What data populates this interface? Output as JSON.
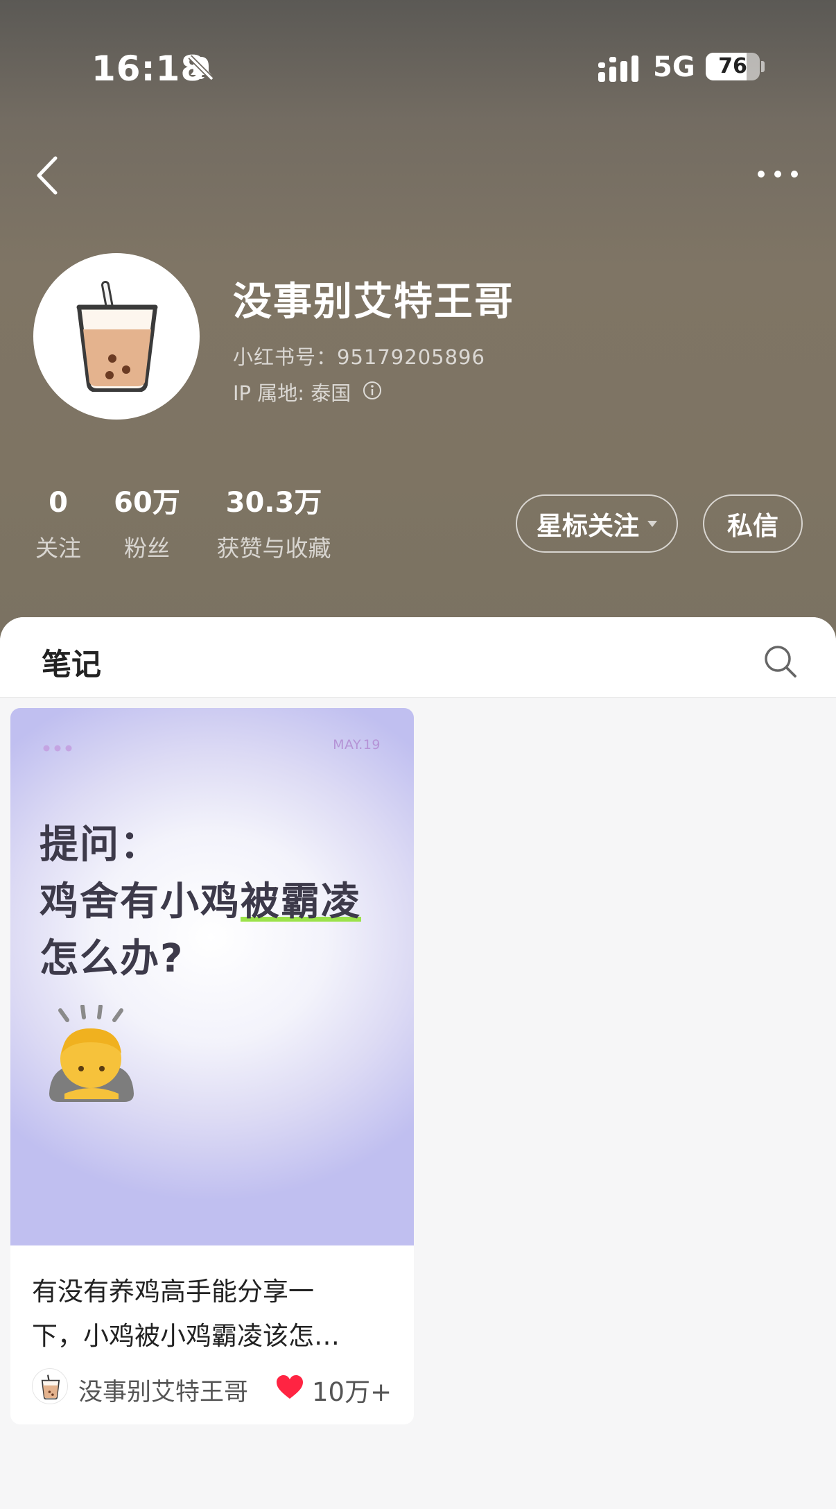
{
  "status_bar": {
    "time": "16:18",
    "network": "5G",
    "battery": "76",
    "battery_level": 0.76
  },
  "profile": {
    "name": "没事别艾特王哥",
    "red_id": "小红书号：95179205896",
    "ip_location": "IP 属地: 泰国"
  },
  "stats": [
    {
      "value": "0",
      "label": "关注"
    },
    {
      "value": "60万",
      "label": "粉丝"
    },
    {
      "value": "30.3万",
      "label": "获赞与收藏"
    }
  ],
  "actions": {
    "follow_label": "星标关注",
    "message_label": "私信"
  },
  "tabs": {
    "notes_label": "笔记"
  },
  "note_card": {
    "cover": {
      "date": "MAY.19",
      "line1": "提问：",
      "line2_plain": "鸡舍有小鸡",
      "line2_highlight": "被霸凌",
      "line3": "怎么办?"
    },
    "title_line1": "有没有养鸡高手能分享一",
    "title_line2": "下，小鸡被小鸡霸凌该怎…",
    "author": "没事别艾特王哥",
    "likes": "10万+"
  },
  "colors": {
    "accent_heart": "#ff2442",
    "highlight": "#9be24a",
    "cover_date": "#b594d6"
  }
}
